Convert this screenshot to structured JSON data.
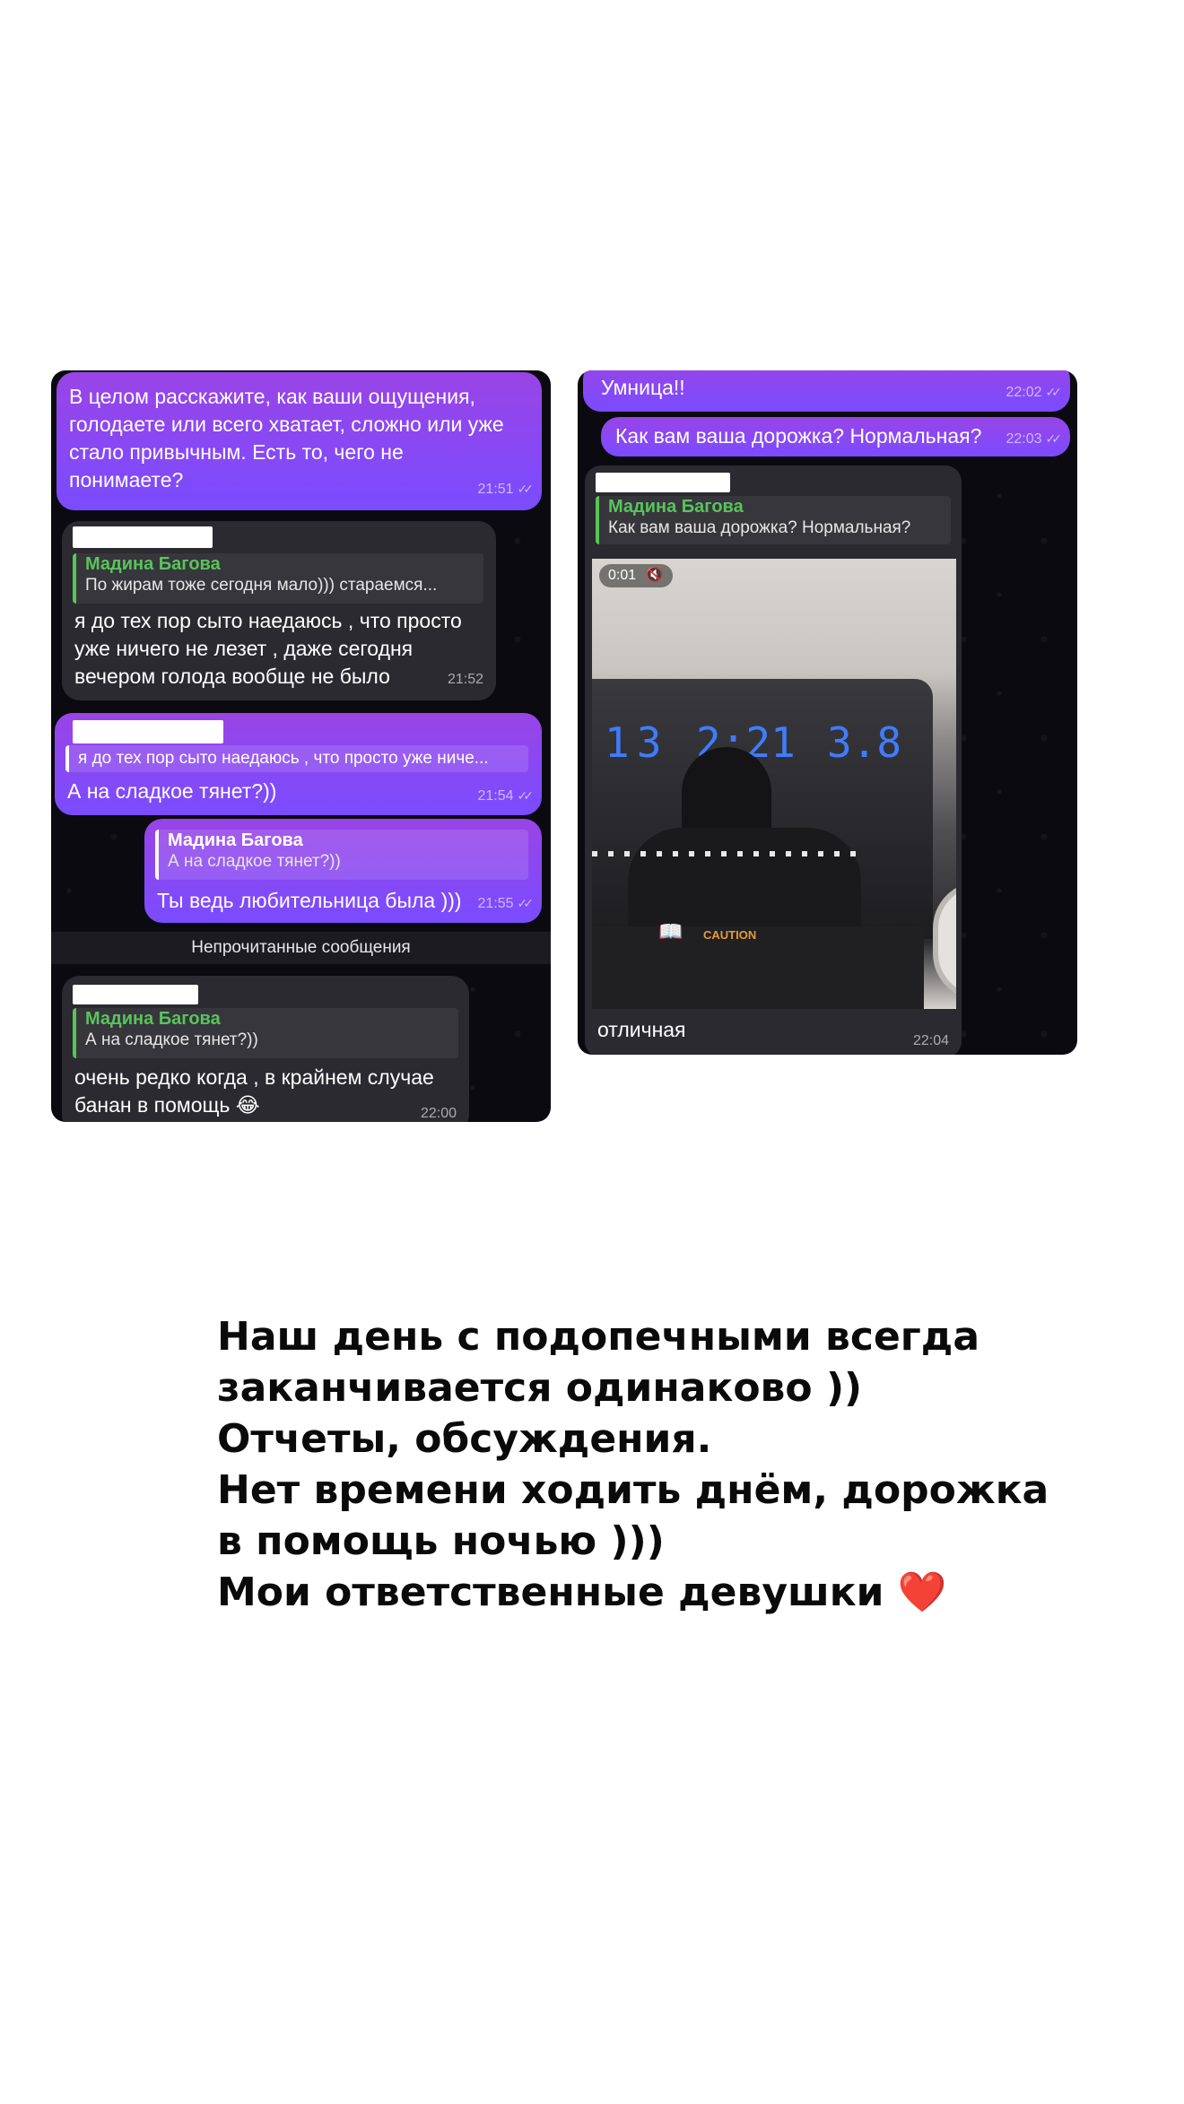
{
  "left_chat": {
    "msg1": {
      "lines": [
        "В целом расскажите, как ваши ощущения,",
        "голодаете или всего хватает, сложно или уже",
        "стало привычным. Есть то, чего не",
        "понимаете?"
      ],
      "time": "21:51"
    },
    "msg2": {
      "reply_name": "Мадина Багова",
      "reply_text": "По жирам тоже сегодня мало))) стараемся...",
      "lines": [
        "я до тех пор сыто наедаюсь , что просто",
        "уже ничего не лезет , даже сегодня",
        "вечером голода вообще не было"
      ],
      "time": "21:52"
    },
    "msg3": {
      "reply_text": "я до тех пор сыто наедаюсь , что просто уже ниче...",
      "text": "А на сладкое тянет?))",
      "time": "21:54"
    },
    "msg4": {
      "reply_name": "Мадина Багова",
      "reply_text": "А на сладкое тянет?))",
      "text": "Ты ведь любительница была )))",
      "time": "21:55"
    },
    "divider": "Непрочитанные сообщения",
    "msg5": {
      "reply_name": "Мадина Багова",
      "reply_text": "А на сладкое тянет?))",
      "lines": [
        "очень редко когда , в крайнем случае",
        "банан в помощь 😂"
      ],
      "time": "22:00"
    }
  },
  "right_chat": {
    "msg1": {
      "text": "Умница!!",
      "time": "22:02"
    },
    "msg2": {
      "text": "Как вам ваша дорожка? Нормальная?",
      "time": "22:03"
    },
    "msg3": {
      "reply_name": "Мадина Багова",
      "reply_text": "Как вам ваша дорожка? Нормальная?",
      "video_duration": "0:01",
      "display": {
        "left": "13",
        "center": "2:21",
        "right": "3.8"
      },
      "caution_label": "CAUTION",
      "caption": "отличная",
      "time": "22:04"
    }
  },
  "caption_lines": [
    "Наш день с подопечными всегда",
    "заканчивается одинаково ))",
    "Отчеты, обсуждения.",
    "Нет времени ходить днём, дорожка",
    "в помощь ночью )))",
    "Мои ответственные девушки"
  ],
  "heart": "❤️",
  "colors": {
    "outgoing_bubble": "#8e44e8",
    "incoming_bubble": "#2a2a30",
    "reply_accent": "#59c45a",
    "chat_background": "#0b0a10",
    "display_digits": "#3f7cff"
  }
}
